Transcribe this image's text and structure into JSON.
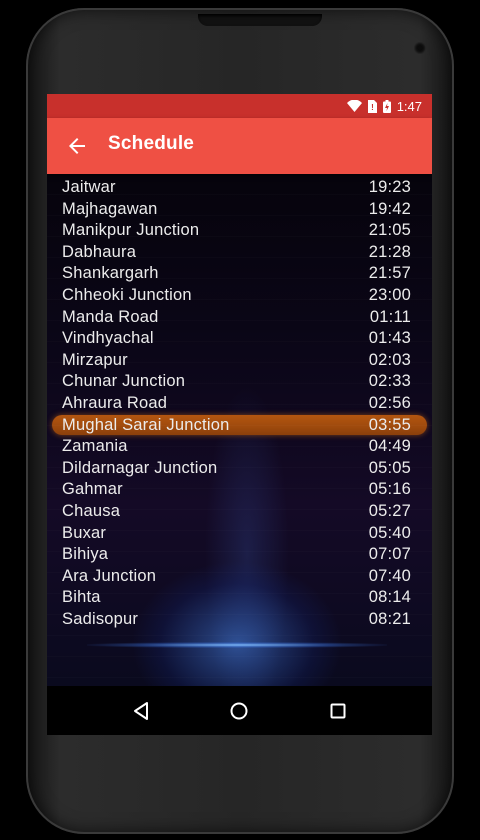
{
  "status_bar": {
    "time": "1:47"
  },
  "app_bar": {
    "title": "Schedule"
  },
  "schedule": [
    {
      "station": "Jaitwar",
      "time": "19:23"
    },
    {
      "station": "Majhagawan",
      "time": "19:42"
    },
    {
      "station": "Manikpur Junction",
      "time": "21:05"
    },
    {
      "station": "Dabhaura",
      "time": "21:28"
    },
    {
      "station": "Shankargarh",
      "time": "21:57"
    },
    {
      "station": "Chheoki Junction",
      "time": "23:00"
    },
    {
      "station": "Manda Road",
      "time": "01:11"
    },
    {
      "station": "Vindhyachal",
      "time": "01:43"
    },
    {
      "station": "Mirzapur",
      "time": "02:03"
    },
    {
      "station": "Chunar Junction",
      "time": "02:33"
    },
    {
      "station": "Ahraura Road",
      "time": "02:56"
    },
    {
      "station": "Mughal Sarai Junction",
      "time": "03:55"
    },
    {
      "station": "Zamania",
      "time": "04:49"
    },
    {
      "station": "Dildarnagar Junction",
      "time": "05:05"
    },
    {
      "station": "Gahmar",
      "time": "05:16"
    },
    {
      "station": "Chausa",
      "time": "05:27"
    },
    {
      "station": "Buxar",
      "time": "05:40"
    },
    {
      "station": "Bihiya",
      "time": "07:07"
    },
    {
      "station": "Ara Junction",
      "time": "07:40"
    },
    {
      "station": "Bihta",
      "time": "08:14"
    },
    {
      "station": "Sadisopur",
      "time": "08:21"
    },
    {
      "station": "",
      "time": ""
    }
  ],
  "highlight_index": 11,
  "colors": {
    "status_bar": "#c8302c",
    "app_bar": "#ef5044",
    "highlight": "#a44c0e"
  },
  "icons": [
    "wifi-icon",
    "no-sim-icon",
    "battery-icon",
    "back-arrow-icon",
    "nav-back-icon",
    "nav-home-icon",
    "nav-recents-icon"
  ]
}
